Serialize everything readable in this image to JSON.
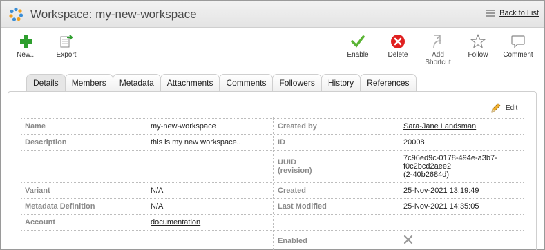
{
  "header": {
    "title": "Workspace: my-new-workspace",
    "back_label": "Back to List"
  },
  "toolbar": {
    "new_label": "New...",
    "export_label": "Export",
    "enable_label": "Enable",
    "delete_label": "Delete",
    "add_shortcut_label": [
      "Add",
      "Shortcut"
    ],
    "follow_label": "Follow",
    "comment_label": "Comment"
  },
  "tabs": [
    "Details",
    "Members",
    "Metadata",
    "Attachments",
    "Comments",
    "Followers",
    "History",
    "References"
  ],
  "active_tab": "Details",
  "edit_label": "Edit",
  "left_fields": [
    {
      "label": "Name",
      "value": "my-new-workspace"
    },
    {
      "label": "Description",
      "value": "this is my new workspace.."
    },
    {
      "label": "",
      "value": ""
    },
    {
      "label": "Variant",
      "value": "N/A"
    },
    {
      "label": "Metadata Definition",
      "value": "N/A"
    },
    {
      "label": "Account",
      "value": "documentation"
    }
  ],
  "right_fields": [
    {
      "label": "Created by",
      "value": "Sara-Jane Landsman"
    },
    {
      "label": "ID",
      "value": "20008"
    },
    {
      "label": "UUID",
      "label2": "(revision)",
      "value": "7c96ed9c-0178-494e-a3b7-",
      "value2": "f0c2bcd2aee2",
      "value3": "(2-40b2684d)"
    },
    {
      "label": "Created",
      "value": "25-Nov-2021 13:19:49"
    },
    {
      "label": "Last Modified",
      "value": "25-Nov-2021 14:35:05"
    },
    {
      "label": "",
      "value": ""
    },
    {
      "label": "Enabled",
      "value": ""
    }
  ],
  "colors": {
    "plus_green": "#2e9e2e",
    "check_green": "#5ab434",
    "delete_red": "#e02020"
  },
  "icons": [
    "workspace-logo-icon",
    "list-icon",
    "plus-icon",
    "export-icon",
    "checkmark-icon",
    "delete-icon",
    "add-shortcut-icon",
    "star-icon",
    "comment-icon",
    "pencil-icon",
    "x-mark-icon"
  ]
}
